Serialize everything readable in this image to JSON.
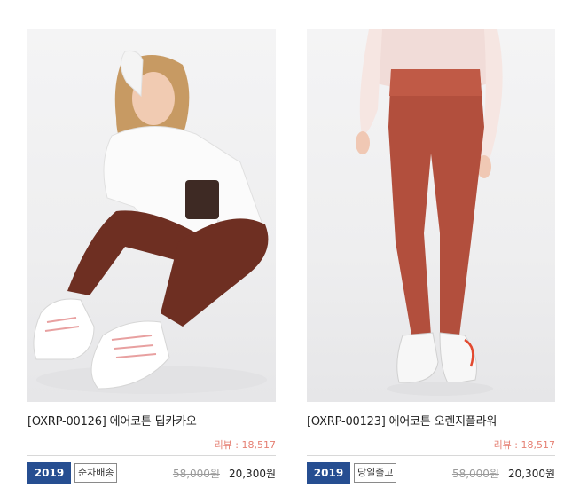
{
  "products": [
    {
      "title": "[OXRP-00126] 에어코튼 딥카카오",
      "review": "리뷰 : 18,517",
      "year_badge": "2019",
      "shipping_badge": "순차배송",
      "original_price": "58,000원",
      "sale_price": "20,300원",
      "leggings_color": "#6e2f22"
    },
    {
      "title": "[OXRP-00123] 에어코튼 오렌지플라워",
      "review": "리뷰 : 18,517",
      "year_badge": "2019",
      "shipping_badge": "당일출고",
      "original_price": "58,000원",
      "sale_price": "20,300원",
      "leggings_color": "#b24f3d"
    }
  ],
  "colors": {
    "year_badge_bg": "#264e91",
    "review_text": "#e57f72"
  }
}
